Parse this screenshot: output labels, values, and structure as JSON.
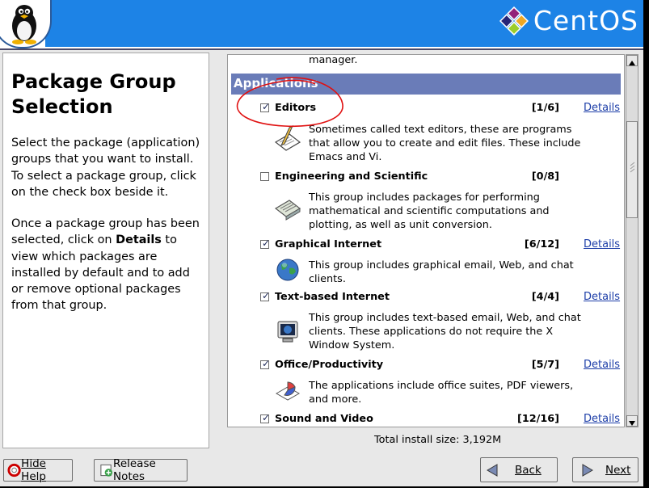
{
  "header": {
    "logo_text": "CentOS"
  },
  "help": {
    "title": "Package Group Selection",
    "para1": "Select the package (application) groups that you want to install. To select a package group, click on the check box beside it.",
    "para2_prefix": "Once a package group has been selected, click on ",
    "para2_bold": "Details",
    "para2_suffix": " to view which packages are installed by default and to add or remove optional packages from that group."
  },
  "list": {
    "top_partial_text": "manager.",
    "category": "Applications",
    "groups": [
      {
        "name": "Editors",
        "checked": true,
        "count": "[1/6]",
        "details": "Details",
        "description": "Sometimes called text editors, these are programs that allow you to create and edit files. These include Emacs and Vi."
      },
      {
        "name": "Engineering and Scientific",
        "checked": false,
        "count": "[0/8]",
        "details": "",
        "description": "This group includes packages for performing mathematical and scientific computations and plotting, as well as unit conversion."
      },
      {
        "name": "Graphical Internet",
        "checked": true,
        "count": "[6/12]",
        "details": "Details",
        "description": "This group includes graphical email, Web, and chat clients."
      },
      {
        "name": "Text-based Internet",
        "checked": true,
        "count": "[4/4]",
        "details": "Details",
        "description": "This group includes text-based email, Web, and chat clients. These applications do not require the X Window System."
      },
      {
        "name": "Office/Productivity",
        "checked": true,
        "count": "[5/7]",
        "details": "Details",
        "description": "The applications include office suites, PDF viewers, and more."
      },
      {
        "name": "Sound and Video",
        "checked": true,
        "count": "[12/16]",
        "details": "Details",
        "description": ""
      }
    ]
  },
  "total_size": "Total install size: 3,192M",
  "buttons": {
    "hide_help": "Hide Help",
    "release_notes": "Release Notes",
    "back": "Back",
    "next": "Next"
  },
  "colors": {
    "header_blue": "#1d83e6",
    "category_bar": "#6a7cb8",
    "link": "#1d3ea8",
    "annotation_red": "#e01010"
  }
}
